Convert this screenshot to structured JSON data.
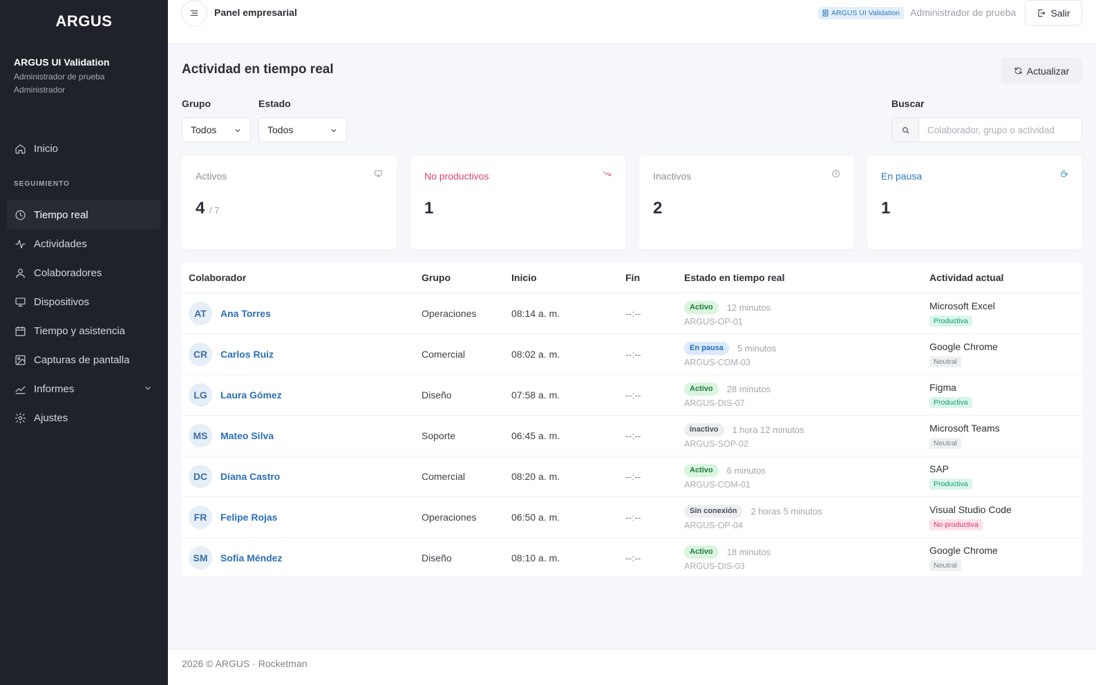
{
  "sidebar": {
    "brand": "ARGUS",
    "org_name": "ARGUS UI Validation",
    "user_name": "Administrador de prueba",
    "user_role": "Administrador",
    "home": "Inicio",
    "section": "SEGUIMIENTO",
    "items": [
      {
        "label": "Tiempo real",
        "icon": "clock-icon"
      },
      {
        "label": "Actividades",
        "icon": "activity-icon"
      },
      {
        "label": "Colaboradores",
        "icon": "user-icon"
      },
      {
        "label": "Dispositivos",
        "icon": "monitor-icon"
      },
      {
        "label": "Tiempo y asistencia",
        "icon": "calendar-icon"
      },
      {
        "label": "Capturas de pantalla",
        "icon": "image-icon"
      },
      {
        "label": "Informes",
        "icon": "chart-icon"
      },
      {
        "label": "Ajustes",
        "icon": "gear-icon"
      }
    ]
  },
  "topbar": {
    "title": "Panel empresarial",
    "org_badge": "ARGUS UI Validation",
    "user": "Administrador de prueba",
    "logout": "Salir"
  },
  "page": {
    "title": "Actividad en tiempo real",
    "refresh": "Actualizar"
  },
  "filters": {
    "group_label": "Grupo",
    "group_value": "Todos",
    "state_label": "Estado",
    "state_value": "Todos",
    "search_label": "Buscar",
    "search_placeholder": "Colaborador, grupo o actividad"
  },
  "cards": {
    "active": {
      "label": "Activos",
      "value": "4",
      "total": "/ 7",
      "color": "#8a9099"
    },
    "unproductive": {
      "label": "No productivos",
      "value": "1",
      "color": "#e0426b"
    },
    "inactive": {
      "label": "Inactivos",
      "value": "2",
      "color": "#8a9099"
    },
    "paused": {
      "label": "En pausa",
      "value": "1",
      "color": "#2a7ac2"
    }
  },
  "table": {
    "headers": {
      "colaborador": "Colaborador",
      "grupo": "Grupo",
      "inicio": "Inicio",
      "fin": "Fin",
      "estado": "Estado en tiempo real",
      "actividad": "Actividad actual"
    },
    "rows": [
      {
        "initials": "AT",
        "name": "Ana Torres",
        "group": "Operaciones",
        "start": "08:14 a. m.",
        "end": "--:--",
        "state": "Activo",
        "state_kind": "active",
        "duration": "12 minutos",
        "device": "ARGUS-OP-01",
        "app": "Microsoft Excel",
        "tag": "Productiva",
        "tag_kind": "productive"
      },
      {
        "initials": "CR",
        "name": "Carlos Ruiz",
        "group": "Comercial",
        "start": "08:02 a. m.",
        "end": "--:--",
        "state": "En pausa",
        "state_kind": "paused",
        "duration": "5 minutos",
        "device": "ARGUS-COM-03",
        "app": "Google Chrome",
        "tag": "Neutral",
        "tag_kind": "neutral"
      },
      {
        "initials": "LG",
        "name": "Laura Gómez",
        "group": "Diseño",
        "start": "07:58 a. m.",
        "end": "--:--",
        "state": "Activo",
        "state_kind": "active",
        "duration": "28 minutos",
        "device": "ARGUS-DIS-07",
        "app": "Figma",
        "tag": "Productiva",
        "tag_kind": "productive"
      },
      {
        "initials": "MS",
        "name": "Mateo Silva",
        "group": "Soporte",
        "start": "06:45 a. m.",
        "end": "--:--",
        "state": "Inactivo",
        "state_kind": "inactive",
        "duration": "1 hora 12 minutos",
        "device": "ARGUS-SOP-02",
        "app": "Microsoft Teams",
        "tag": "Neutral",
        "tag_kind": "neutral"
      },
      {
        "initials": "DC",
        "name": "Diana Castro",
        "group": "Comercial",
        "start": "08:20 a. m.",
        "end": "--:--",
        "state": "Activo",
        "state_kind": "active",
        "duration": "6 minutos",
        "device": "ARGUS-COM-01",
        "app": "SAP",
        "tag": "Productiva",
        "tag_kind": "productive"
      },
      {
        "initials": "FR",
        "name": "Felipe Rojas",
        "group": "Operaciones",
        "start": "06:50 a. m.",
        "end": "--:--",
        "state": "Sin conexión",
        "state_kind": "offline",
        "duration": "2 horas 5 minutos",
        "device": "ARGUS-OP-04",
        "app": "Visual Studio Code",
        "tag": "No productiva",
        "tag_kind": "unproductive"
      },
      {
        "initials": "SM",
        "name": "Sofía Méndez",
        "group": "Diseño",
        "start": "08:10 a. m.",
        "end": "--:--",
        "state": "Activo",
        "state_kind": "active",
        "duration": "18 minutos",
        "device": "ARGUS-DIS-03",
        "app": "Google Chrome",
        "tag": "Neutral",
        "tag_kind": "neutral"
      }
    ]
  },
  "footer": "2026 © ARGUS · Rocketman",
  "colors": {
    "sidebar_bg": "#1f2329",
    "link": "#2a6eb5",
    "active_badge_bg": "#d9f5df",
    "active_badge_fg": "#1f7a3a",
    "paused_badge_bg": "#dbe9fb",
    "paused_badge_fg": "#2a6eb5",
    "inactive_badge_bg": "#eceef1",
    "inactive_badge_fg": "#4a5058",
    "productive_tag_bg": "#d8f6ea",
    "productive_tag_fg": "#15966a",
    "neutral_tag_bg": "#eef0f2",
    "neutral_tag_fg": "#7b818a",
    "unproductive_tag_bg": "#fde2ea",
    "unproductive_tag_fg": "#d7335f"
  }
}
